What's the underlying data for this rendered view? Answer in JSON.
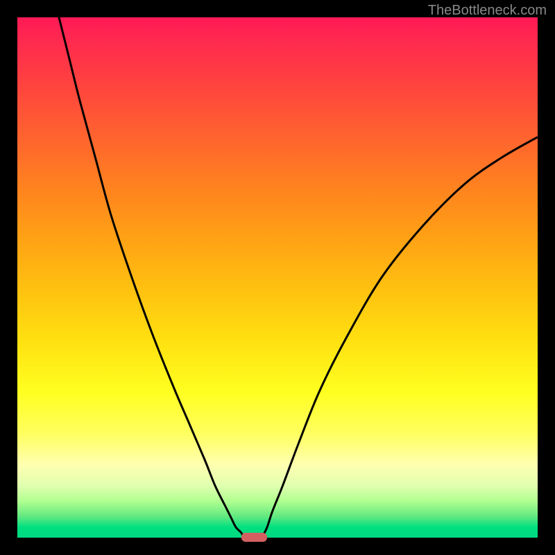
{
  "watermark": "TheBottleneck.com",
  "chart_data": {
    "type": "line",
    "title": "",
    "xlabel": "",
    "ylabel": "",
    "xlim": [
      0,
      100
    ],
    "ylim": [
      0,
      100
    ],
    "series": [
      {
        "name": "left-curve",
        "x": [
          8,
          10,
          12,
          15,
          18,
          22,
          26,
          30,
          33,
          36,
          38,
          40,
          41,
          42,
          43,
          43.5
        ],
        "y": [
          100,
          92,
          84,
          73,
          62,
          50,
          39,
          29,
          22,
          15,
          10,
          6,
          4,
          2,
          1,
          0
        ]
      },
      {
        "name": "right-curve",
        "x": [
          47,
          48,
          49,
          51,
          54,
          58,
          63,
          70,
          78,
          86,
          93,
          100
        ],
        "y": [
          0,
          2,
          5,
          10,
          18,
          28,
          38,
          50,
          60,
          68,
          73,
          77
        ]
      }
    ],
    "marker": {
      "x_start": 43,
      "x_end": 48,
      "y": 0
    },
    "gradient_colors": {
      "top": "#ff1955",
      "bottom": "#00d880"
    }
  },
  "layout": {
    "total_size": 800,
    "margin": 25,
    "chart_size": 750
  }
}
